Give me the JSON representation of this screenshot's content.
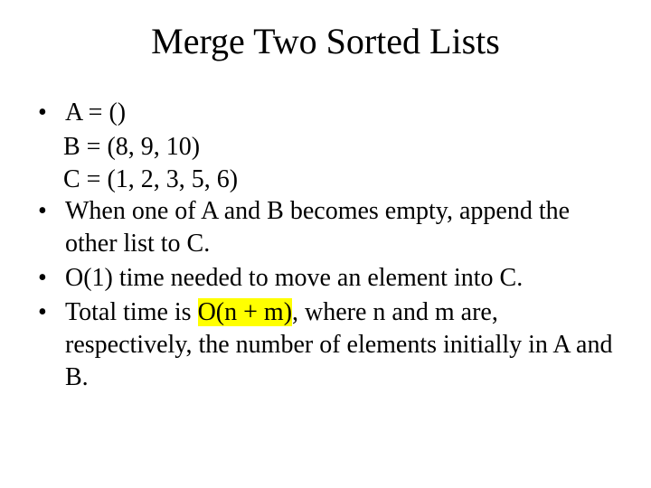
{
  "title": "Merge Two Sorted Lists",
  "bullet1": {
    "line1": "A = ()",
    "line2": "B = (8, 9, 10)",
    "line3": "C = (1, 2, 3, 5, 6)"
  },
  "bullet2": "When one of  A and B becomes empty, append the other list to C.",
  "bullet3": "O(1) time needed to move an element into C.",
  "bullet4_pre": "Total time is ",
  "bullet4_hl": "O(n + m)",
  "bullet4_post": ", where n and m are, respectively, the number of elements initially in A and B.",
  "dot": "•"
}
